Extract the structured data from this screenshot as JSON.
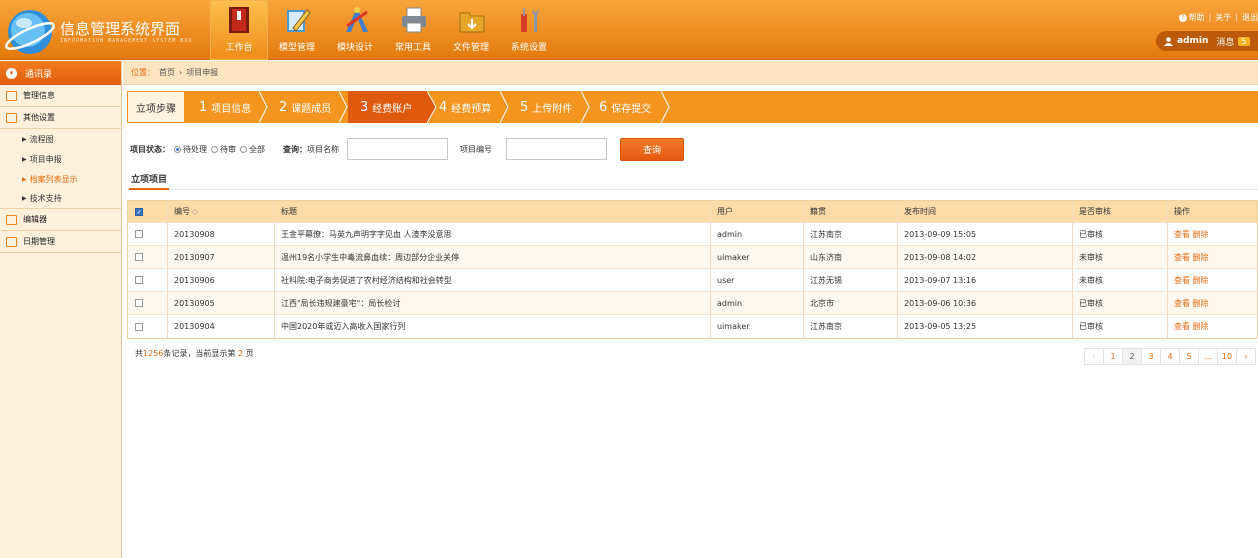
{
  "header": {
    "title": "信息管理系统界面",
    "subtitle": "INFORMATION MANAGEMENT SYSTEM BOX",
    "nav": [
      {
        "label": "工作台",
        "icon": "book-icon"
      },
      {
        "label": "模型管理",
        "icon": "pencil-note-icon"
      },
      {
        "label": "模块设计",
        "icon": "design-tools-icon"
      },
      {
        "label": "常用工具",
        "icon": "printer-icon"
      },
      {
        "label": "文件管理",
        "icon": "folder-icon"
      },
      {
        "label": "系统设置",
        "icon": "tools-icon"
      }
    ],
    "links": {
      "help": "帮助",
      "about": "关于",
      "exit": "退出"
    },
    "user": {
      "name": "admin",
      "messages_label": "消息",
      "messages_count": "5"
    }
  },
  "sidebar": {
    "head": "通讯录",
    "groups": [
      {
        "label": "管理信息"
      },
      {
        "label": "其他设置",
        "items": [
          "流程图",
          "项目申报",
          "档案列表显示",
          "技术支持"
        ]
      },
      {
        "label": "编辑器"
      },
      {
        "label": "日期管理"
      }
    ]
  },
  "breadcrumb": {
    "label": "位置：",
    "home": "首页",
    "sep": "›",
    "current": "项目申报"
  },
  "steps": {
    "title": "立项步骤",
    "items": [
      {
        "num": "1",
        "label": "项目信息"
      },
      {
        "num": "2",
        "label": "课题成员"
      },
      {
        "num": "3",
        "label": "经费账户"
      },
      {
        "num": "4",
        "label": "经费预算"
      },
      {
        "num": "5",
        "label": "上传附件"
      },
      {
        "num": "6",
        "label": "保存提交"
      }
    ]
  },
  "filter": {
    "status_label": "项目状态：",
    "options": [
      "待处理",
      "待审",
      "全部"
    ],
    "query_label": "查询：",
    "name_label": "项目名称",
    "code_label": "项目编号",
    "name_value": "",
    "code_value": "",
    "button": "查询"
  },
  "tab": "立项项目",
  "table": {
    "headers": [
      "编号",
      "标题",
      "用户",
      "籍贯",
      "发布时间",
      "是否审核",
      "操作"
    ],
    "sort_mark": "◇",
    "rows": [
      {
        "id": "20130908",
        "title": "王金平幕僚：马英九声明字字见血 人渣李没意思",
        "user": "admin",
        "place": "江苏南京",
        "time": "2013-09-09 15:05",
        "status": "已审核",
        "view": "查看",
        "del": "删除"
      },
      {
        "id": "20130907",
        "title": "温州19名小学生中毒流鼻血续：周边部分企业关停",
        "user": "uimaker",
        "place": "山东济南",
        "time": "2013-09-08 14:02",
        "status": "未审核",
        "view": "查看",
        "del": "删除"
      },
      {
        "id": "20130906",
        "title": "社科院:电子商务促进了农村经济结构和社会转型",
        "user": "user",
        "place": "江苏无锡",
        "time": "2013-09-07 13:16",
        "status": "未审核",
        "view": "查看",
        "del": "删除"
      },
      {
        "id": "20130905",
        "title": "江西\"局长违规建豪宅\"：局长检讨",
        "user": "admin",
        "place": "北京市",
        "time": "2013-09-06 10:36",
        "status": "已审核",
        "view": "查看",
        "del": "删除"
      },
      {
        "id": "20130904",
        "title": "中国2020年或迈入高收入国家行列",
        "user": "uimaker",
        "place": "江苏南京",
        "time": "2013-09-05 13:25",
        "status": "已审核",
        "view": "查看",
        "del": "删除"
      }
    ]
  },
  "summary": {
    "prefix": "共",
    "total": "1256",
    "mid": "条记录，当前显示第",
    "page": "2",
    "suffix": "页"
  },
  "pager": {
    "prev": "‹",
    "pages": [
      "1",
      "2",
      "3",
      "4",
      "5",
      "...",
      "10"
    ],
    "next": "›",
    "current": "2"
  },
  "colors": {
    "accent": "#e86a10",
    "header": "#f39422",
    "step_active": "#e05a0e"
  }
}
